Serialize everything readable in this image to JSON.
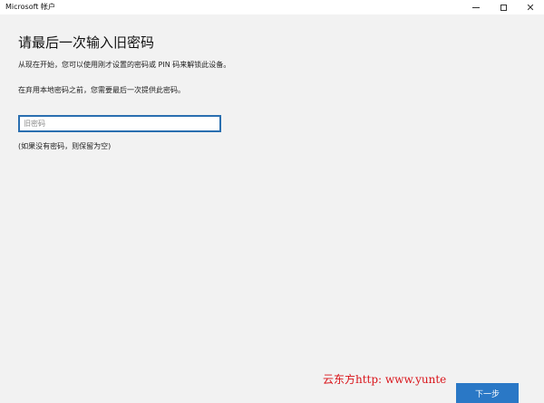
{
  "window": {
    "title": "Microsoft 帐户",
    "controls": {
      "minimize_icon": "minimize-icon",
      "maximize_icon": "maximize-icon",
      "close_icon": "close-icon"
    }
  },
  "main": {
    "heading": "请最后一次输入旧密码",
    "description_1": "从现在开始，您可以使用刚才设置的密码或 PIN 码来解锁此设备。",
    "description_2": "在弃用本地密码之前，您需要最后一次提供此密码。",
    "password_input": {
      "placeholder": "旧密码",
      "value": ""
    },
    "hint": "(如果没有密码，则保留为空)"
  },
  "footer": {
    "next_label": "下一步",
    "watermark": "云东方http: www.yunte"
  },
  "colors": {
    "accent": "#2a78c6",
    "input_border": "#2a6fb0",
    "background": "#f2f2f2",
    "watermark": "#d9141a"
  }
}
